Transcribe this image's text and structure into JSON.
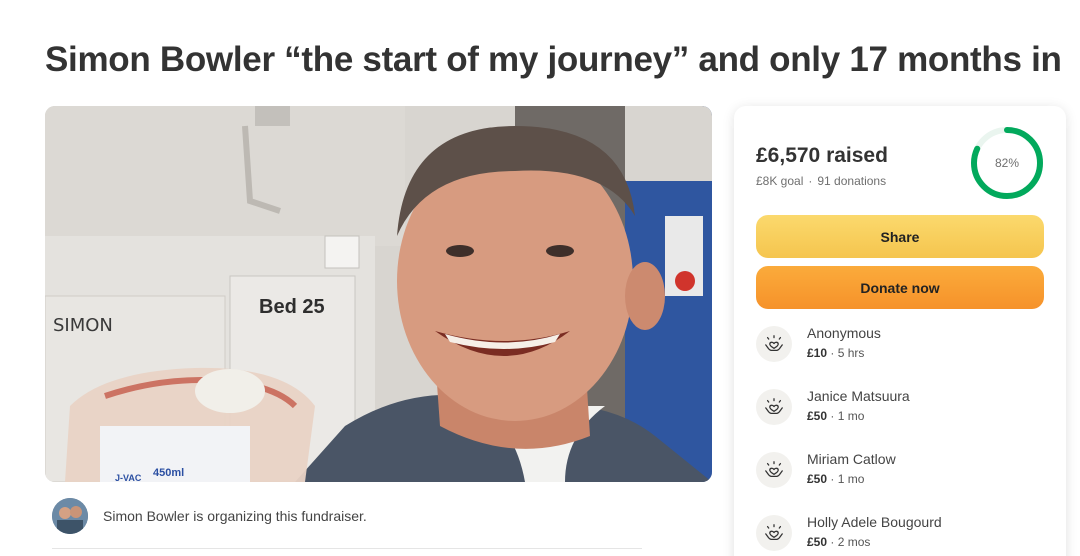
{
  "title": "Simon Bowler “the start of my journey” and only 17 months in",
  "hero": {
    "bed_sign": "Bed 25",
    "name_sign": "SIMON",
    "bag_volume": "450ml",
    "bag_brand": "J-VAC"
  },
  "organizer": {
    "text": "Simon Bowler is organizing this fundraiser."
  },
  "summary": {
    "raised": "£6,570 raised",
    "goal": "£8K goal",
    "separator": "·",
    "donations": "91 donations",
    "percent_label": "82%",
    "progress": 0.82,
    "accent": "#02a95c"
  },
  "buttons": {
    "share": "Share",
    "donate": "Donate now"
  },
  "donations": [
    {
      "name": "Anonymous",
      "amount": "£10",
      "time": "5 hrs"
    },
    {
      "name": "Janice Matsuura",
      "amount": "£50",
      "time": "1 mo"
    },
    {
      "name": "Miriam Catlow",
      "amount": "£50",
      "time": "1 mo"
    },
    {
      "name": "Holly Adele Bougourd",
      "amount": "£50",
      "time": "2 mos"
    }
  ],
  "donation_icon": "heart-hands-icon"
}
